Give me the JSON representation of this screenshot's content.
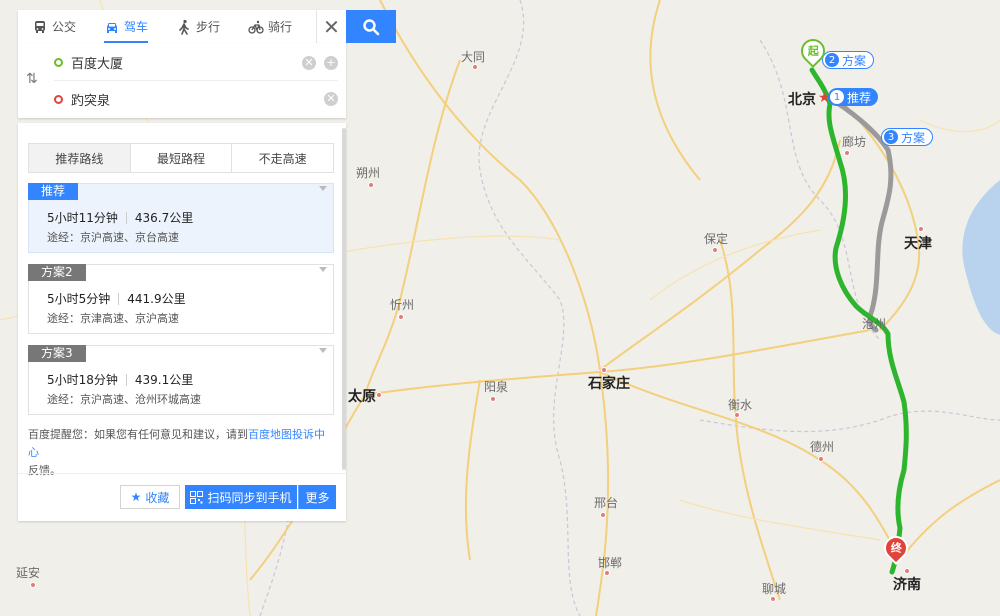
{
  "modes": [
    {
      "label": "公交",
      "icon": "bus-icon"
    },
    {
      "label": "驾车",
      "icon": "car-icon",
      "active": true
    },
    {
      "label": "步行",
      "icon": "walk-icon"
    },
    {
      "label": "骑行",
      "icon": "bike-icon"
    }
  ],
  "route": {
    "start": "百度大厦",
    "end": "趵突泉"
  },
  "tabs": [
    "推荐路线",
    "最短路程",
    "不走高速"
  ],
  "plans": [
    {
      "tag": "推荐",
      "time": "5小时11分钟",
      "distance": "436.7公里",
      "via": "途经：京沪高速、京台高速"
    },
    {
      "tag": "方案2",
      "time": "5小时5分钟",
      "distance": "441.9公里",
      "via": "途经：京津高速、京沪高速"
    },
    {
      "tag": "方案3",
      "time": "5小时18分钟",
      "distance": "439.1公里",
      "via": "途经：京沪高速、沧州环城高速"
    }
  ],
  "tip": {
    "prefix": "百度提醒您：如果您有任何意见和建议，请到",
    "link": "百度地图投诉中心",
    "suffix": "反馈。"
  },
  "actions": {
    "favorite": "收藏",
    "sync": "扫码同步到手机",
    "more": "更多"
  },
  "map": {
    "cities": [
      {
        "name": "北京",
        "major": true
      },
      {
        "name": "天津",
        "major": true
      },
      {
        "name": "石家庄",
        "major": true
      },
      {
        "name": "济南",
        "major": true
      },
      {
        "name": "太原",
        "major": true
      },
      {
        "name": "大同"
      },
      {
        "name": "朔州"
      },
      {
        "name": "忻州"
      },
      {
        "name": "阳泉"
      },
      {
        "name": "保定"
      },
      {
        "name": "廊坊"
      },
      {
        "name": "沧州"
      },
      {
        "name": "衡水"
      },
      {
        "name": "德州"
      },
      {
        "name": "邢台"
      },
      {
        "name": "邯郸"
      },
      {
        "name": "聊城"
      },
      {
        "name": "延安"
      }
    ],
    "bubbles": [
      {
        "num": "1",
        "label": "推荐"
      },
      {
        "num": "2",
        "label": "方案"
      },
      {
        "num": "3",
        "label": "方案"
      }
    ],
    "start_pin": "起",
    "end_pin": "终",
    "colors": {
      "primary_route": "#2db52d",
      "alt_route": "#9a9a9a",
      "accent": "#3385ff"
    }
  }
}
